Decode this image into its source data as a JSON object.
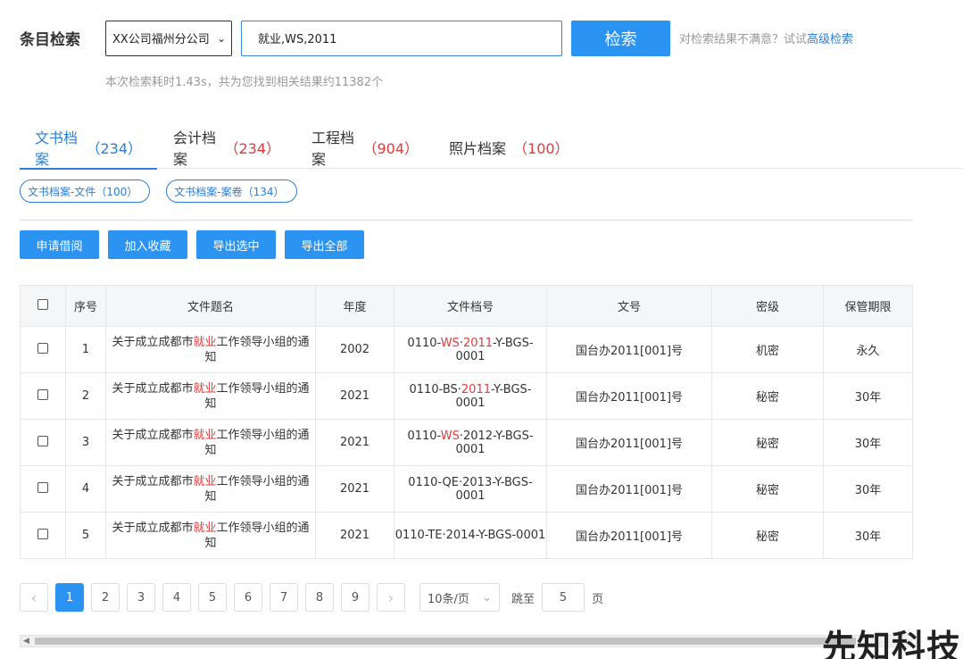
{
  "search": {
    "title": "条目检索",
    "org": "XX公司福州分公司",
    "query": "就业,WS,2011",
    "button": "检索",
    "hint": "对检索结果不满意？试试",
    "advanced": "高级检索",
    "stats": "本次检索耗时1.43s，共为您找到相关结果约11382个"
  },
  "tabs": [
    {
      "label": "文书档案",
      "count": "（234）"
    },
    {
      "label": "会计档案",
      "count": "（234）"
    },
    {
      "label": "工程档案",
      "count": "（904）"
    },
    {
      "label": "照片档案",
      "count": "（100）"
    }
  ],
  "chips": [
    "文书档案-文件（100）",
    "文书档案-案卷（134）"
  ],
  "actions": [
    "申请借阅",
    "加入收藏",
    "导出选中",
    "导出全部"
  ],
  "table": {
    "headers": [
      "序号",
      "文件题名",
      "年度",
      "文件档号",
      "文号",
      "密级",
      "保管期限"
    ],
    "rows": [
      {
        "no": "1",
        "t1": "关于成立成都市",
        "thl": "就业",
        "t2": "工作领导小组的通知",
        "year": "2002",
        "a1": "0110-",
        "ahl1": "WS",
        "a2": "·",
        "ahl2": "2011",
        "a3": "-Y-BGS-0001",
        "doc": "国台办2011[001]号",
        "level": "机密",
        "period": "永久"
      },
      {
        "no": "2",
        "t1": "关于成立成都市",
        "thl": "就业",
        "t2": "工作领导小组的通知",
        "year": "2021",
        "a1": "0110-BS·",
        "ahl1": "",
        "a2": "",
        "ahl2": "2011",
        "a3": "-Y-BGS-0001",
        "doc": "国台办2011[001]号",
        "level": "秘密",
        "period": "30年"
      },
      {
        "no": "3",
        "t1": "关于成立成都市",
        "thl": "就业",
        "t2": "工作领导小组的通知",
        "year": "2021",
        "a1": "0110-",
        "ahl1": "WS",
        "a2": "·2012-Y-BGS-0001",
        "ahl2": "",
        "a3": "",
        "doc": "国台办2011[001]号",
        "level": "秘密",
        "period": "30年"
      },
      {
        "no": "4",
        "t1": "关于成立成都市",
        "thl": "就业",
        "t2": "工作领导小组的通知",
        "year": "2021",
        "a1": "0110-QE·2013-Y-BGS-0001",
        "ahl1": "",
        "a2": "",
        "ahl2": "",
        "a3": "",
        "doc": "国台办2011[001]号",
        "level": "秘密",
        "period": "30年"
      },
      {
        "no": "5",
        "t1": "关于成立成都市",
        "thl": "就业",
        "t2": "工作领导小组的通知",
        "year": "2021",
        "a1": "0110-TE·2014-Y-BGS-0001",
        "ahl1": "",
        "a2": "",
        "ahl2": "",
        "a3": "",
        "doc": "国台办2011[001]号",
        "level": "秘密",
        "period": "30年"
      }
    ]
  },
  "pager": {
    "pages": [
      "1",
      "2",
      "3",
      "4",
      "5",
      "6",
      "7",
      "8",
      "9"
    ],
    "page_size": "10条/页",
    "jump_label": "跳至",
    "jump_value": "5",
    "unit": "页"
  },
  "watermark": "先知科技",
  "colors": {
    "primary": "#2b94f2",
    "link": "#2b7fd8",
    "highlight": "#e03b3b"
  }
}
